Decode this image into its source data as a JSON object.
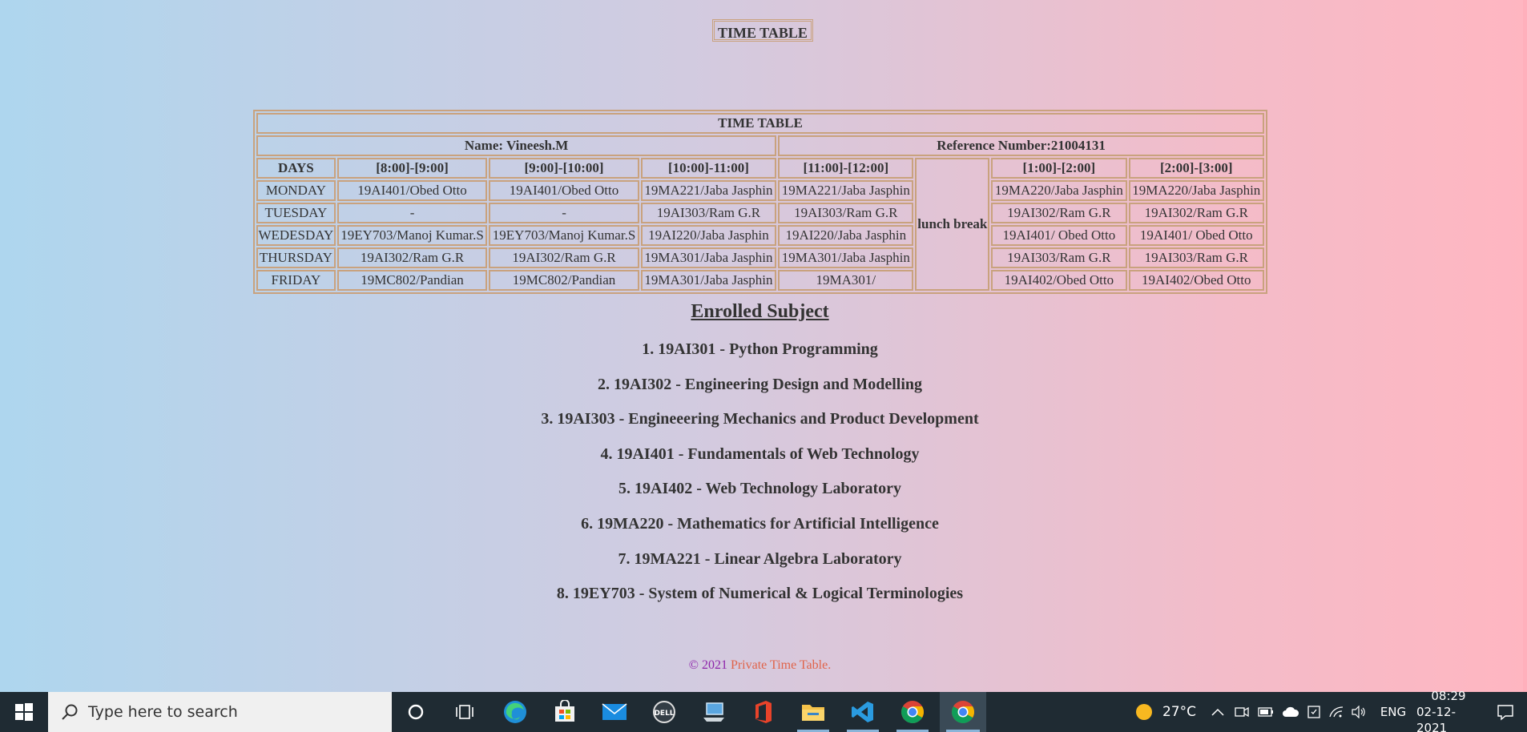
{
  "header": {
    "title": "TIME TABLE"
  },
  "timetable": {
    "caption": "TIME TABLE",
    "name": "Name: Vineesh.M",
    "reference": "Reference Number:21004131",
    "columns": [
      "DAYS",
      "[8:00]-[9:00]",
      "[9:00]-[10:00]",
      "[10:00]-11:00]",
      "[11:00]-[12:00]",
      "[1:00]-[2:00]",
      "[2:00]-[3:00]"
    ],
    "lunch": "lunch break",
    "rows": [
      {
        "day": "MONDAY",
        "cells": [
          "19AI401/Obed Otto",
          "19AI401/Obed Otto",
          "19MA221/Jaba Jasphin",
          "19MA221/Jaba Jasphin",
          "19MA220/Jaba Jasphin",
          "19MA220/Jaba Jasphin"
        ]
      },
      {
        "day": "TUESDAY",
        "cells": [
          "-",
          "-",
          "19AI303/Ram G.R",
          "19AI303/Ram G.R",
          "19AI302/Ram G.R",
          "19AI302/Ram G.R"
        ]
      },
      {
        "day": "WEDESDAY",
        "cells": [
          "19EY703/Manoj Kumar.S",
          "19EY703/Manoj Kumar.S",
          "19AI220/Jaba Jasphin",
          "19AI220/Jaba Jasphin",
          "19AI401/ Obed Otto",
          "19AI401/ Obed Otto"
        ]
      },
      {
        "day": "THURSDAY",
        "cells": [
          "19AI302/Ram G.R",
          "19AI302/Ram G.R",
          "19MA301/Jaba Jasphin",
          "19MA301/Jaba Jasphin",
          "19AI303/Ram G.R",
          "19AI303/Ram G.R"
        ]
      },
      {
        "day": "FRIDAY",
        "cells": [
          "19MC802/Pandian",
          "19MC802/Pandian",
          "19MA301/Jaba Jasphin",
          "19MA301/",
          "19AI402/Obed Otto",
          "19AI402/Obed Otto"
        ]
      }
    ]
  },
  "enrolled": {
    "title": "Enrolled Subject",
    "subjects": [
      "1. 19AI301 - Python Programming",
      "2. 19AI302 - Engineering Design and Modelling",
      "3. 19AI303 - Engineeering Mechanics and Product Development",
      "4. 19AI401 - Fundamentals of Web Technology",
      "5. 19AI402 - Web Technology Laboratory",
      "6. 19MA220 - Mathematics for Artificial Intelligence",
      "7. 19MA221 - Linear Algebra Laboratory",
      "8. 19EY703 - System of Numerical & Logical Terminologies"
    ]
  },
  "footer": {
    "copyright": "© 2021",
    "link": "Private Time Table."
  },
  "taskbar": {
    "search_placeholder": "Type here to search",
    "apps": [
      "cortana-icon",
      "task-view-icon",
      "edge-icon",
      "store-icon",
      "mail-icon",
      "dell-icon",
      "computer-icon",
      "office-icon",
      "file-explorer-icon",
      "vscode-icon",
      "chrome-icon",
      "chrome-active-icon"
    ],
    "weather": "27°C",
    "language": "ENG",
    "time": "08:29",
    "date": "02-12-2021",
    "colors": {
      "taskbar": "#1f2b33",
      "active": "#3a4a56",
      "accent": "#8ab4d8"
    }
  },
  "colors": {
    "border": "#c9a27e",
    "gradient_left": "#aed6ee",
    "gradient_right": "#ffb6c1",
    "footer_copyright": "#8e24aa",
    "footer_link": "#e0644a"
  }
}
